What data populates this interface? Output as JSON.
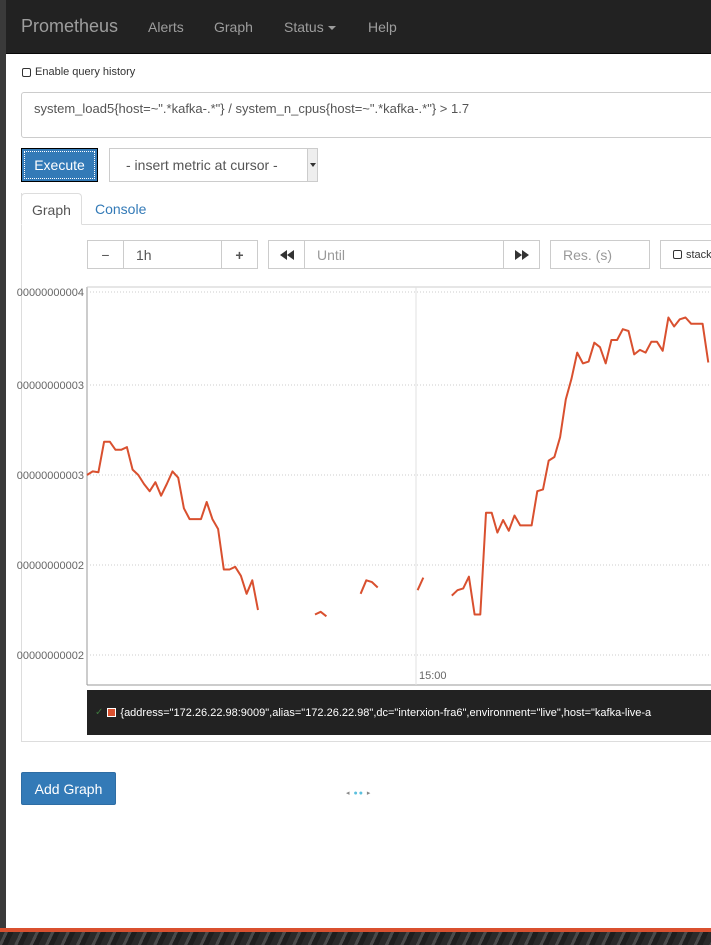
{
  "navbar": {
    "brand": "Prometheus",
    "items": [
      "Alerts",
      "Graph",
      "Status",
      "Help"
    ]
  },
  "history": {
    "label": "Enable query history",
    "checked": false
  },
  "expression": {
    "value": "system_load5{host=~\".*kafka-.*\"} / system_n_cpus{host=~\".*kafka-.*\"} > 1.7"
  },
  "controls": {
    "execute_label": "Execute",
    "metric_select": "- insert metric at cursor -",
    "tabs": [
      "Graph",
      "Console"
    ],
    "range_minus": "−",
    "range_value": "1h",
    "range_plus": "+",
    "until_placeholder": "Until",
    "res_placeholder": "Res. (s)",
    "stacked_label": "stack"
  },
  "chart_data": {
    "type": "line",
    "color": "#d9502f",
    "y_tick_labels": [
      "00000000004",
      "00000000003",
      "00000000003",
      "00000000002",
      "00000000002"
    ],
    "x_tick_labels": [
      "15:00"
    ],
    "series": [
      {
        "name": "{address=\"172.26.22.98:9009\",alias=\"172.26.22.98\",dc=\"interxion-fra6\",environment=\"live\",host=\"kafka-live-a",
        "segments": [
          [
            [
              0,
              2.0
            ],
            [
              1,
              2.04
            ],
            [
              2,
              2.03
            ],
            [
              3,
              2.37
            ],
            [
              4,
              2.37
            ],
            [
              5,
              2.28
            ],
            [
              6,
              2.28
            ],
            [
              7,
              2.31
            ],
            [
              8,
              2.06
            ],
            [
              9,
              2.0
            ],
            [
              10,
              1.9
            ],
            [
              11,
              1.82
            ],
            [
              12,
              1.92
            ],
            [
              13,
              1.77
            ],
            [
              14,
              1.9
            ],
            [
              15,
              2.04
            ],
            [
              16,
              1.97
            ],
            [
              17,
              1.63
            ],
            [
              18,
              1.51
            ],
            [
              19,
              1.51
            ],
            [
              20,
              1.51
            ],
            [
              21,
              1.7
            ],
            [
              22,
              1.51
            ],
            [
              23,
              1.4
            ],
            [
              24,
              0.95
            ],
            [
              25,
              0.95
            ],
            [
              26,
              0.98
            ],
            [
              27,
              0.88
            ],
            [
              28,
              0.68
            ],
            [
              29,
              0.83
            ],
            [
              30,
              0.5
            ]
          ],
          [
            [
              40,
              0.45
            ],
            [
              41,
              0.48
            ],
            [
              42,
              0.43
            ]
          ],
          [
            [
              48,
              0.68
            ],
            [
              49,
              0.83
            ],
            [
              50,
              0.81
            ],
            [
              51,
              0.75
            ]
          ],
          [
            [
              58,
              0.72
            ],
            [
              59,
              0.86
            ]
          ],
          [
            [
              64,
              0.66
            ],
            [
              65,
              0.72
            ],
            [
              66,
              0.74
            ],
            [
              67,
              0.87
            ],
            [
              68,
              0.45
            ],
            [
              69,
              0.45
            ],
            [
              70,
              1.58
            ],
            [
              71,
              1.58
            ],
            [
              72,
              1.36
            ],
            [
              73,
              1.5
            ],
            [
              74,
              1.38
            ],
            [
              75,
              1.55
            ],
            [
              76,
              1.44
            ],
            [
              77,
              1.44
            ],
            [
              78,
              1.44
            ],
            [
              79,
              1.82
            ],
            [
              80,
              1.84
            ],
            [
              81,
              2.16
            ],
            [
              82,
              2.2
            ],
            [
              83,
              2.42
            ],
            [
              84,
              2.84
            ],
            [
              85,
              3.07
            ],
            [
              86,
              3.36
            ],
            [
              87,
              3.24
            ],
            [
              88,
              3.26
            ],
            [
              89,
              3.47
            ],
            [
              90,
              3.42
            ],
            [
              91,
              3.24
            ],
            [
              92,
              3.5
            ],
            [
              93,
              3.5
            ],
            [
              94,
              3.62
            ],
            [
              95,
              3.6
            ],
            [
              96,
              3.34
            ],
            [
              97,
              3.39
            ],
            [
              98,
              3.36
            ],
            [
              99,
              3.48
            ],
            [
              100,
              3.48
            ],
            [
              101,
              3.38
            ],
            [
              102,
              3.75
            ],
            [
              103,
              3.65
            ],
            [
              104,
              3.73
            ],
            [
              105,
              3.75
            ],
            [
              106,
              3.68
            ],
            [
              107,
              3.68
            ],
            [
              108,
              3.68
            ],
            [
              109,
              3.25
            ]
          ]
        ]
      }
    ]
  }
}
